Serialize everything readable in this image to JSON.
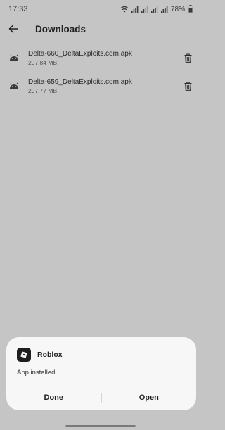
{
  "status_bar": {
    "time": "17:33",
    "battery": "78%"
  },
  "app_bar": {
    "title": "Downloads"
  },
  "files": [
    {
      "name": "Delta-660_DeltaExploits.com.apk",
      "size": "207.84 MB",
      "icon": "android-icon"
    },
    {
      "name": "Delta-659_DeltaExploits.com.apk",
      "size": "207.77 MB",
      "icon": "android-icon"
    }
  ],
  "dialog": {
    "app_name": "Roblox",
    "message": "App installed.",
    "done_label": "Done",
    "open_label": "Open"
  },
  "colors": {
    "background": "#c5c5c5",
    "dialog": "#f7f7f7",
    "text": "#2b2b2b"
  }
}
